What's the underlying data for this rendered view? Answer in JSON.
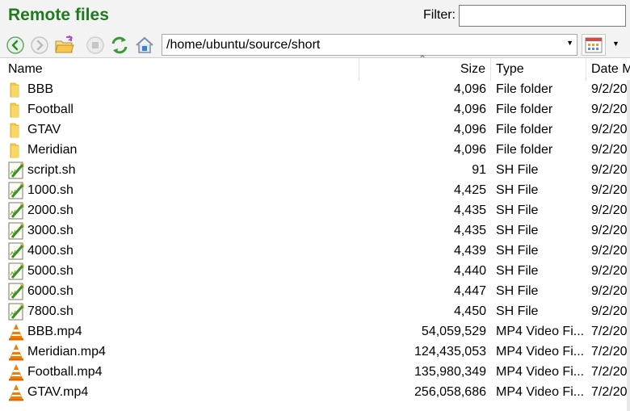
{
  "panel": {
    "title": "Remote files",
    "filter_label": "Filter:",
    "filter_value": ""
  },
  "toolbar": {
    "path": "/home/ubuntu/source/short",
    "buttons": [
      "back-icon",
      "forward-icon",
      "folder-open-icon",
      "stop-icon",
      "refresh-icon",
      "home-icon"
    ],
    "view_button": "view-grid-icon"
  },
  "columns": {
    "name": "Name",
    "size": "Size",
    "type": "Type",
    "date": "Date M"
  },
  "files": [
    {
      "name": "BBB",
      "size": "4,096",
      "type": "File folder",
      "date": "9/2/20",
      "icon": "folder-icon"
    },
    {
      "name": "Football",
      "size": "4,096",
      "type": "File folder",
      "date": "9/2/20",
      "icon": "folder-icon"
    },
    {
      "name": "GTAV",
      "size": "4,096",
      "type": "File folder",
      "date": "9/2/20",
      "icon": "folder-icon"
    },
    {
      "name": "Meridian",
      "size": "4,096",
      "type": "File folder",
      "date": "9/2/20",
      "icon": "folder-icon"
    },
    {
      "name": "script.sh",
      "size": "91",
      "type": "SH File",
      "date": "9/2/20",
      "icon": "script-icon"
    },
    {
      "name": "1000.sh",
      "size": "4,425",
      "type": "SH File",
      "date": "9/2/20",
      "icon": "script-icon"
    },
    {
      "name": "2000.sh",
      "size": "4,435",
      "type": "SH File",
      "date": "9/2/20",
      "icon": "script-icon"
    },
    {
      "name": "3000.sh",
      "size": "4,435",
      "type": "SH File",
      "date": "9/2/20",
      "icon": "script-icon"
    },
    {
      "name": "4000.sh",
      "size": "4,439",
      "type": "SH File",
      "date": "9/2/20",
      "icon": "script-icon"
    },
    {
      "name": "5000.sh",
      "size": "4,440",
      "type": "SH File",
      "date": "9/2/20,",
      "icon": "script-icon"
    },
    {
      "name": "6000.sh",
      "size": "4,447",
      "type": "SH File",
      "date": "9/2/20",
      "icon": "script-icon"
    },
    {
      "name": "7800.sh",
      "size": "4,450",
      "type": "SH File",
      "date": "9/2/20",
      "icon": "script-icon"
    },
    {
      "name": "BBB.mp4",
      "size": "54,059,529",
      "type": "MP4 Video Fi...",
      "date": "7/2/20",
      "icon": "vlc-cone-icon"
    },
    {
      "name": "Meridian.mp4",
      "size": "124,435,053",
      "type": "MP4 Video Fi...",
      "date": "7/2/20",
      "icon": "vlc-cone-icon"
    },
    {
      "name": "Football.mp4",
      "size": "135,980,349",
      "type": "MP4 Video Fi...",
      "date": "7/2/20",
      "icon": "vlc-cone-icon"
    },
    {
      "name": "GTAV.mp4",
      "size": "256,058,686",
      "type": "MP4 Video Fi...",
      "date": "7/2/20",
      "icon": "vlc-cone-icon"
    }
  ],
  "colors": {
    "title_green": "#1e7b1e",
    "folder_yellow": "#f6c945",
    "script_green": "#7ab53a",
    "vlc_orange": "#f07d00"
  }
}
